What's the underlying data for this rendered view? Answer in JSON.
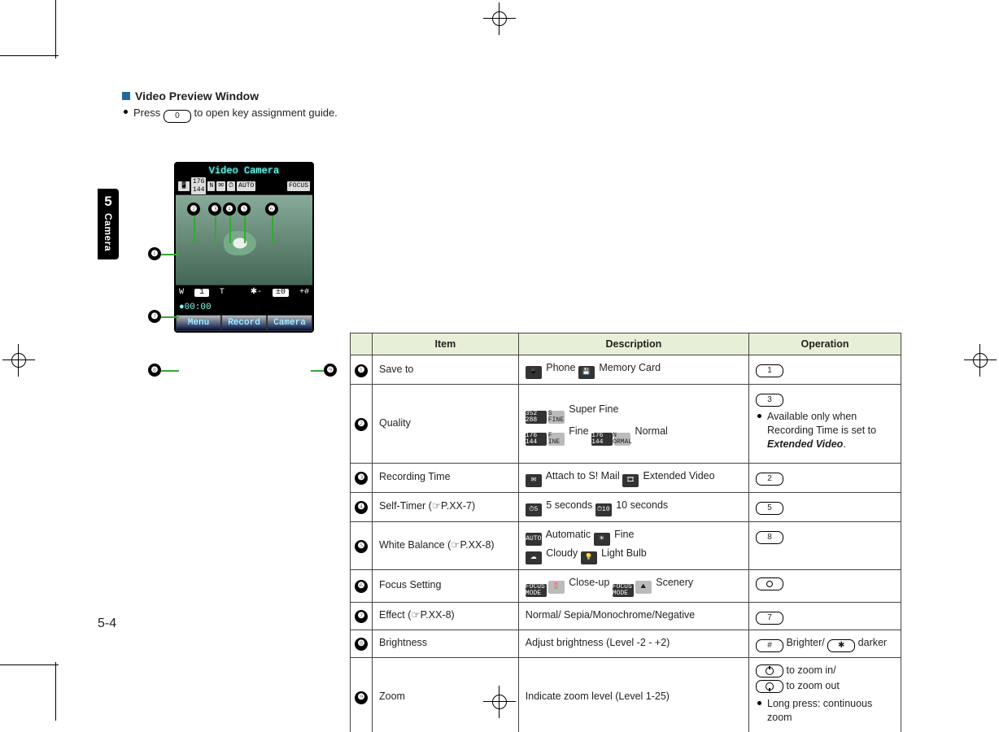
{
  "sideTab": {
    "chapterNumber": "5",
    "chapterLabel": "Camera"
  },
  "pageNumber": "5-4",
  "heading": {
    "title": "Video Preview Window",
    "note_pre": "Press ",
    "key": "0",
    "note_post": " to open key assignment guide."
  },
  "mock": {
    "title": "Video Camera",
    "timer": "00:00",
    "zoom": {
      "left": "W",
      "mid": "1",
      "right": "T"
    },
    "bright": {
      "left": "✱-",
      "mid": "±0",
      "right": "+#"
    },
    "softkeys": {
      "left": "Menu",
      "center": "Record",
      "right": "Camera"
    }
  },
  "callouts": [
    "❶",
    "❷",
    "❸",
    "❹",
    "❺",
    "❻",
    "❼",
    "❽",
    "❾"
  ],
  "table": {
    "headers": {
      "item": "Item",
      "desc": "Description",
      "op": "Operation"
    },
    "rows": [
      {
        "idx": "❶",
        "item": "Save to",
        "descParts": [
          {
            "icon": "📱",
            "t": "Phone"
          },
          {
            "icon": "💾",
            "t": "Memory Card"
          }
        ],
        "opKeys": [
          "1"
        ],
        "opNote": ""
      },
      {
        "idx": "❷",
        "item": "Quality",
        "descParts": [
          {
            "icon": "352 288",
            "icon2": "S FINE",
            "t": "Super Fine"
          },
          {
            "br": true
          },
          {
            "icon": "176 144",
            "icon2": "F INE",
            "t": "Fine"
          },
          {
            "icon": "176 144",
            "icon2": "N ORMAL",
            "t": "Normal"
          }
        ],
        "opKeys": [
          "3"
        ],
        "opNote": "Available only when Recording Time is set to ",
        "opNoteItalic": "Extended Video",
        "opNoteEnd": "."
      },
      {
        "idx": "❸",
        "item": "Recording Time",
        "descParts": [
          {
            "icon": "✉",
            "t": "Attach to S! Mail"
          },
          {
            "icon": "🎞",
            "t": "Extended Video"
          }
        ],
        "opKeys": [
          "2"
        ]
      },
      {
        "idx": "❹",
        "item": "Self-Timer (☞P.XX-7)",
        "descParts": [
          {
            "icon": "⏱5",
            "t": "5 seconds"
          },
          {
            "icon": "⏱10",
            "t": "10 seconds"
          }
        ],
        "opKeys": [
          "5"
        ]
      },
      {
        "idx": "❺",
        "item": "White Balance (☞P.XX-8)",
        "descParts": [
          {
            "icon": "AUTO",
            "t": "Automatic"
          },
          {
            "icon": "☀",
            "t": "Fine"
          },
          {
            "br": true
          },
          {
            "icon": "☁",
            "t": "Cloudy"
          },
          {
            "icon": "💡",
            "t": "Light Bulb"
          }
        ],
        "opKeys": [
          "8"
        ]
      },
      {
        "idx": "❻",
        "item": "Focus Setting",
        "descParts": [
          {
            "icon": "FOCUS MODE",
            "icon2": "🌷",
            "t": "Close-up"
          },
          {
            "icon": "FOCUS MODE",
            "icon2": "⛰",
            "t": "Scenery"
          }
        ],
        "opKeys": [
          "○"
        ]
      },
      {
        "idx": "❼",
        "item": "Effect (☞P.XX-8)",
        "descPlain": "Normal/ Sepia/Monochrome/Negative",
        "opKeys": [
          "7"
        ]
      },
      {
        "idx": "❽",
        "item": "Brightness",
        "descPlain": "Adjust brightness (Level -2 - +2)",
        "opKeys": [
          "#"
        ],
        "opJoin1": " Brighter/ ",
        "opKeys2": [
          "✱"
        ],
        "opJoin2": " darker"
      },
      {
        "idx": "❾",
        "item": "Zoom",
        "descPlain": "Indicate zoom level (Level 1-25)",
        "opDpad": true,
        "opDpadIn": " to zoom in/",
        "opDpadOut": " to zoom out",
        "opNote": "Long press: continuous zoom"
      }
    ]
  }
}
